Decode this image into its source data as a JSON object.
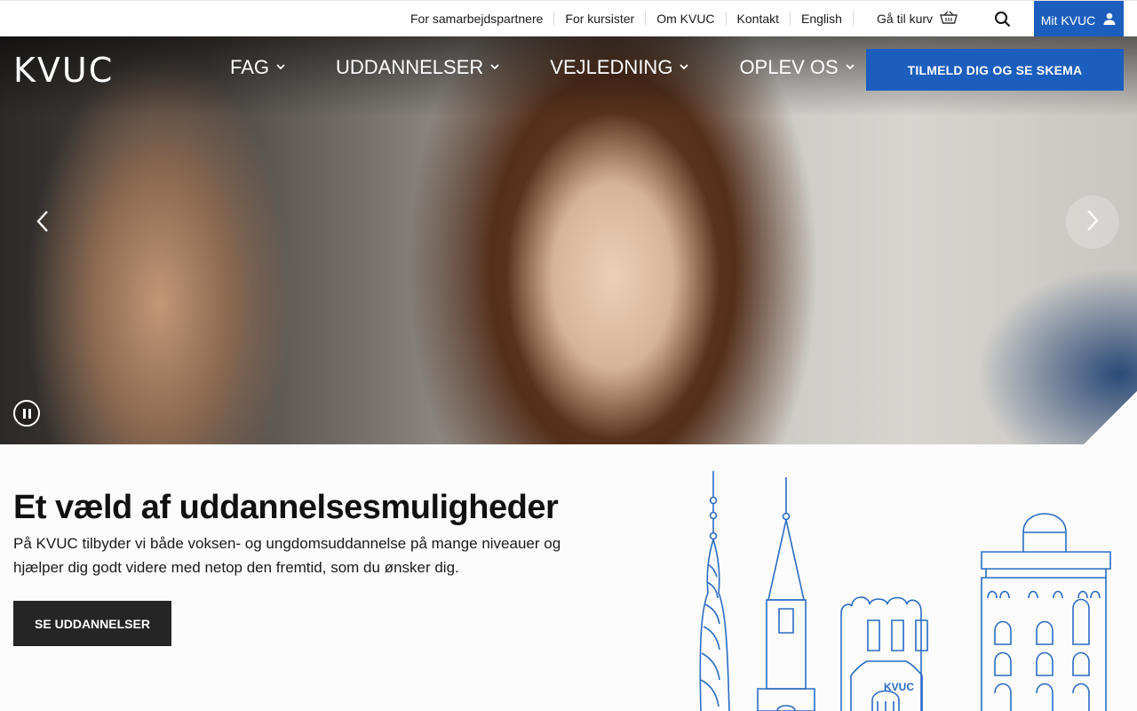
{
  "topbar": {
    "links": [
      "For samarbejdspartnere",
      "For kursister",
      "Om KVUC",
      "Kontakt",
      "English"
    ],
    "cart_label": "Gå til kurv",
    "mit_label": "Mit KVUC"
  },
  "header": {
    "logo_text": "KVUC",
    "nav": [
      "FAG",
      "UDDANNELSER",
      "VEJLEDNING",
      "OPLEV OS"
    ],
    "cta_label": "TILMELD DIG OG SE SKEMA"
  },
  "main": {
    "headline": "Et væld af uddannelsesmuligheder",
    "body": "På KVUC tilbyder vi både voksen- og ungdomsuddannelse på mange niveauer og hjælper dig godt videre med netop den fremtid, som du ønsker dig.",
    "button_label": "SE UDDANNELSER",
    "illustration_label": "KVUC"
  },
  "colors": {
    "accent": "#1c5ebd",
    "dark_button": "#252525",
    "illustration": "#2a6bc4"
  },
  "icons": [
    "basket-icon",
    "search-icon",
    "user-icon",
    "chevron-down-icon",
    "chevron-left-icon",
    "chevron-right-icon",
    "pause-icon"
  ]
}
